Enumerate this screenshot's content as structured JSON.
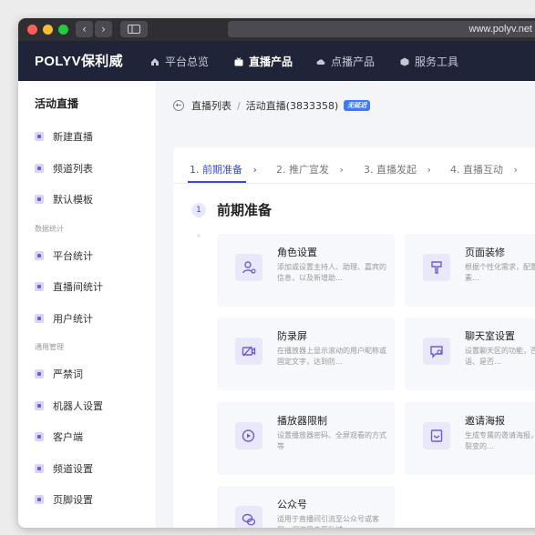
{
  "browser": {
    "url": "www.polyv.net",
    "back_glyph": "‹",
    "forward_glyph": "›"
  },
  "app": {
    "logo": "POLYV保利威",
    "nav": [
      {
        "label": "平台总览",
        "icon": "home-icon"
      },
      {
        "label": "直播产品",
        "icon": "tv-icon",
        "active": true
      },
      {
        "label": "点播产品",
        "icon": "cloud-icon"
      },
      {
        "label": "服务工具",
        "icon": "box-icon"
      }
    ]
  },
  "sidebar": {
    "title": "活动直播",
    "items": [
      {
        "label": "新建直播"
      },
      {
        "label": "频道列表"
      },
      {
        "label": "默认模板"
      }
    ],
    "group_stats": "数据统计",
    "stats_items": [
      {
        "label": "平台统计"
      },
      {
        "label": "直播间统计"
      },
      {
        "label": "用户统计"
      }
    ],
    "group_manage": "通用管理",
    "manage_items": [
      {
        "label": "严禁词"
      },
      {
        "label": "机器人设置"
      },
      {
        "label": "客户端"
      },
      {
        "label": "频道设置"
      },
      {
        "label": "页脚设置"
      }
    ]
  },
  "breadcrumb": {
    "back_glyph": "←",
    "parent": "直播列表",
    "separator": "/",
    "current": "活动直播(3833358)",
    "badge": "无延迟"
  },
  "steps": [
    {
      "label": "1. 前期准备",
      "active": true
    },
    {
      "label": "2. 推广宣发"
    },
    {
      "label": "3. 直播发起"
    },
    {
      "label": "4. 直播互动"
    }
  ],
  "step_arrow": "›",
  "section": {
    "number": "1",
    "title": "前期准备"
  },
  "cards": [
    {
      "title": "角色设置",
      "desc": "添加或设置主持人、助理、嘉宾的信息，以及新增助…",
      "icon": "user-settings-icon"
    },
    {
      "title": "页面装修",
      "desc": "根据个性化需求，配置直播间元素…",
      "icon": "brush-icon"
    },
    {
      "title": "防录屏",
      "desc": "在播放器上显示滚动的用户昵称或固定文字，达到防…",
      "icon": "no-record-icon"
    },
    {
      "title": "聊天室设置",
      "desc": "设置聊天区的功能，否显示欢迎语、是否…",
      "icon": "chat-settings-icon"
    },
    {
      "title": "播放器限制",
      "desc": "设置播放器密码、全屏观看的方式等",
      "icon": "player-icon"
    },
    {
      "title": "邀请海报",
      "desc": "生成专属的邀请海报，直播间分享裂变的…",
      "icon": "poster-icon"
    },
    {
      "title": "公众号",
      "desc": "适用于直播间引流至公众号或客服，沉淀用户至私域…",
      "icon": "wechat-icon"
    }
  ],
  "colors": {
    "accent": "#3b4ad8",
    "appbar": "#1f2438",
    "titlebar": "#2f2f33",
    "mac_red": "#ff5f57",
    "mac_yellow": "#febc2e",
    "mac_green": "#28c840"
  }
}
